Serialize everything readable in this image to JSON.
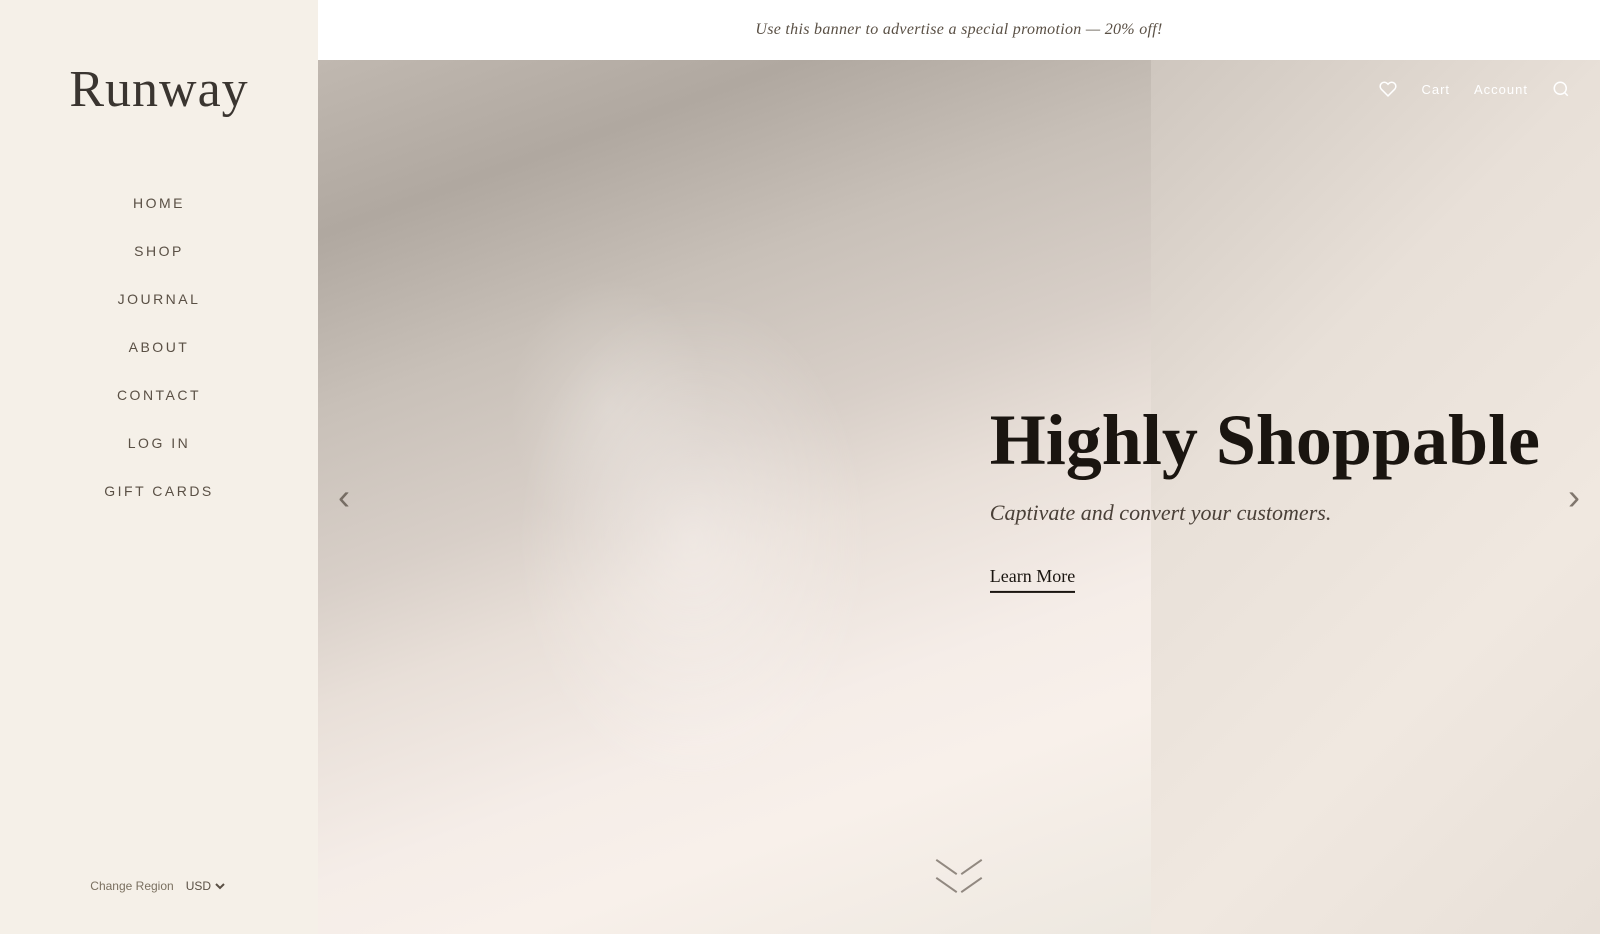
{
  "sidebar": {
    "logo": "Runway",
    "nav_items": [
      {
        "label": "HOME",
        "id": "home"
      },
      {
        "label": "SHOP",
        "id": "shop"
      },
      {
        "label": "JOURNAL",
        "id": "journal"
      },
      {
        "label": "ABOUT",
        "id": "about"
      },
      {
        "label": "CONTACT",
        "id": "contact"
      },
      {
        "label": "LOG IN",
        "id": "login"
      },
      {
        "label": "GIFT CARDS",
        "id": "gift-cards"
      }
    ],
    "change_region_label": "Change Region",
    "currency": "USD"
  },
  "banner": {
    "text": "Use this banner to advertise a special promotion — 20% off!"
  },
  "header": {
    "cart_label": "Cart",
    "account_label": "Account"
  },
  "hero": {
    "headline": "Highly Shoppable",
    "subtext": "Captivate and convert your customers.",
    "cta_label": "Learn More",
    "arrow_left": "‹",
    "arrow_right": "›"
  },
  "colors": {
    "sidebar_bg": "#f5f0e8",
    "logo_color": "#3a3530",
    "nav_color": "#5a5045",
    "banner_bg": "#ffffff",
    "hero_headline_color": "#1a1510",
    "hero_sub_color": "#4a4038"
  }
}
